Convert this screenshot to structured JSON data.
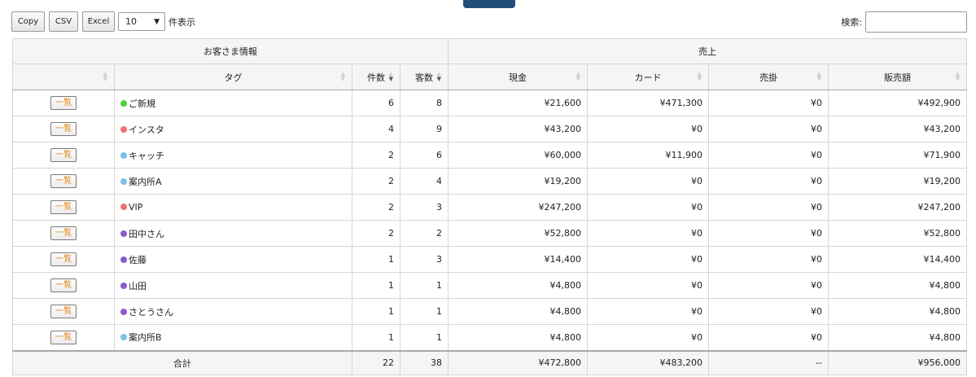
{
  "toolbar": {
    "copy_label": "Copy",
    "csv_label": "CSV",
    "excel_label": "Excel",
    "length_value": "10",
    "length_suffix": "件表示"
  },
  "search": {
    "label": "検索:",
    "value": ""
  },
  "table": {
    "groups": [
      "お客さま情報",
      "売上"
    ],
    "columns": [
      "",
      "タグ",
      "件数",
      "客数",
      "現金",
      "カード",
      "売掛",
      "販売額"
    ],
    "list_button_label": "一覧",
    "rows": [
      {
        "tag": "ご新規",
        "color": "#4cd137",
        "count": "6",
        "customers": "8",
        "cash": "¥21,600",
        "card": "¥471,300",
        "credit": "¥0",
        "sales": "¥492,900"
      },
      {
        "tag": "インスタ",
        "color": "#e8736e",
        "count": "4",
        "customers": "9",
        "cash": "¥43,200",
        "card": "¥0",
        "credit": "¥0",
        "sales": "¥43,200"
      },
      {
        "tag": "キャッチ",
        "color": "#7fbfe8",
        "count": "2",
        "customers": "6",
        "cash": "¥60,000",
        "card": "¥11,900",
        "credit": "¥0",
        "sales": "¥71,900"
      },
      {
        "tag": "案内所A",
        "color": "#7fbfe8",
        "count": "2",
        "customers": "4",
        "cash": "¥19,200",
        "card": "¥0",
        "credit": "¥0",
        "sales": "¥19,200"
      },
      {
        "tag": "VIP",
        "color": "#e8736e",
        "count": "2",
        "customers": "3",
        "cash": "¥247,200",
        "card": "¥0",
        "credit": "¥0",
        "sales": "¥247,200"
      },
      {
        "tag": "田中さん",
        "color": "#8a5cd0",
        "count": "2",
        "customers": "2",
        "cash": "¥52,800",
        "card": "¥0",
        "credit": "¥0",
        "sales": "¥52,800"
      },
      {
        "tag": "佐藤",
        "color": "#8a5cd0",
        "count": "1",
        "customers": "3",
        "cash": "¥14,400",
        "card": "¥0",
        "credit": "¥0",
        "sales": "¥14,400"
      },
      {
        "tag": "山田",
        "color": "#8a5cd0",
        "count": "1",
        "customers": "1",
        "cash": "¥4,800",
        "card": "¥0",
        "credit": "¥0",
        "sales": "¥4,800"
      },
      {
        "tag": "さとうさん",
        "color": "#8a5cd0",
        "count": "1",
        "customers": "1",
        "cash": "¥4,800",
        "card": "¥0",
        "credit": "¥0",
        "sales": "¥4,800"
      },
      {
        "tag": "案内所B",
        "color": "#7fbfe8",
        "count": "1",
        "customers": "1",
        "cash": "¥4,800",
        "card": "¥0",
        "credit": "¥0",
        "sales": "¥4,800"
      }
    ],
    "footer": {
      "label": "合計",
      "count": "22",
      "customers": "38",
      "cash": "¥472,800",
      "card": "¥483,200",
      "credit": "--",
      "sales": "¥956,000"
    }
  },
  "colors": {
    "header_bg": "#f5f5f5",
    "list_button_text": "#e08a1e",
    "top_button": "#1f4e79"
  }
}
